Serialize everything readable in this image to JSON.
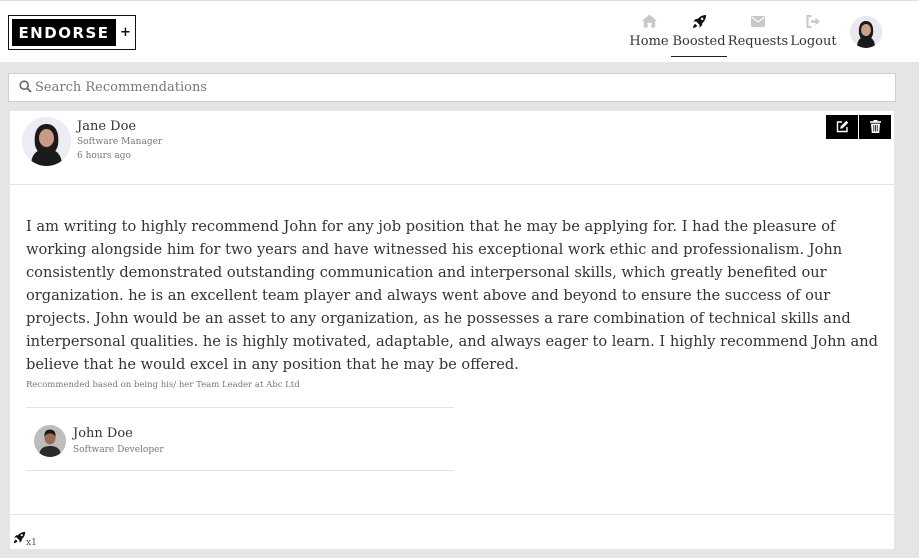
{
  "brand": {
    "name": "ENDORSE",
    "plus": "+"
  },
  "nav": {
    "home": {
      "label": "Home",
      "icon": "home-icon"
    },
    "boosted": {
      "label": "Boosted",
      "icon": "rocket-icon"
    },
    "requests": {
      "label": "Requests",
      "icon": "envelope-icon"
    },
    "logout": {
      "label": "Logout",
      "icon": "sign-out-icon"
    }
  },
  "search": {
    "placeholder": "Search Recommendations",
    "value": ""
  },
  "recommendation": {
    "author": {
      "name": "Jane Doe",
      "role": "Software Manager",
      "time": "6 hours ago"
    },
    "text": "I am writing to highly recommend John for any job position that he may be applying for. I had the pleasure of working alongside him for two years and have witnessed his exceptional work ethic and professionalism. John consistently demonstrated outstanding communication and interpersonal skills, which greatly benefited our organization. he is an excellent team player and always went above and beyond to ensure the success of our projects. John would be an asset to any organization, as he possesses a rare combination of technical skills and interpersonal qualities. he is highly motivated, adaptable, and always eager to learn. I highly recommend John and believe that he would excel in any position that he may be offered.",
    "basis": "Recommended based on being his/ her Team Leader at Abc Ltd",
    "recipient": {
      "name": "John Doe",
      "role": "Software Developer"
    },
    "boosts": "x1"
  },
  "colors": {
    "accent": "#000000",
    "background": "#e5e5e5",
    "card": "#ffffff",
    "inactive_icon": "#c8c8c8"
  }
}
